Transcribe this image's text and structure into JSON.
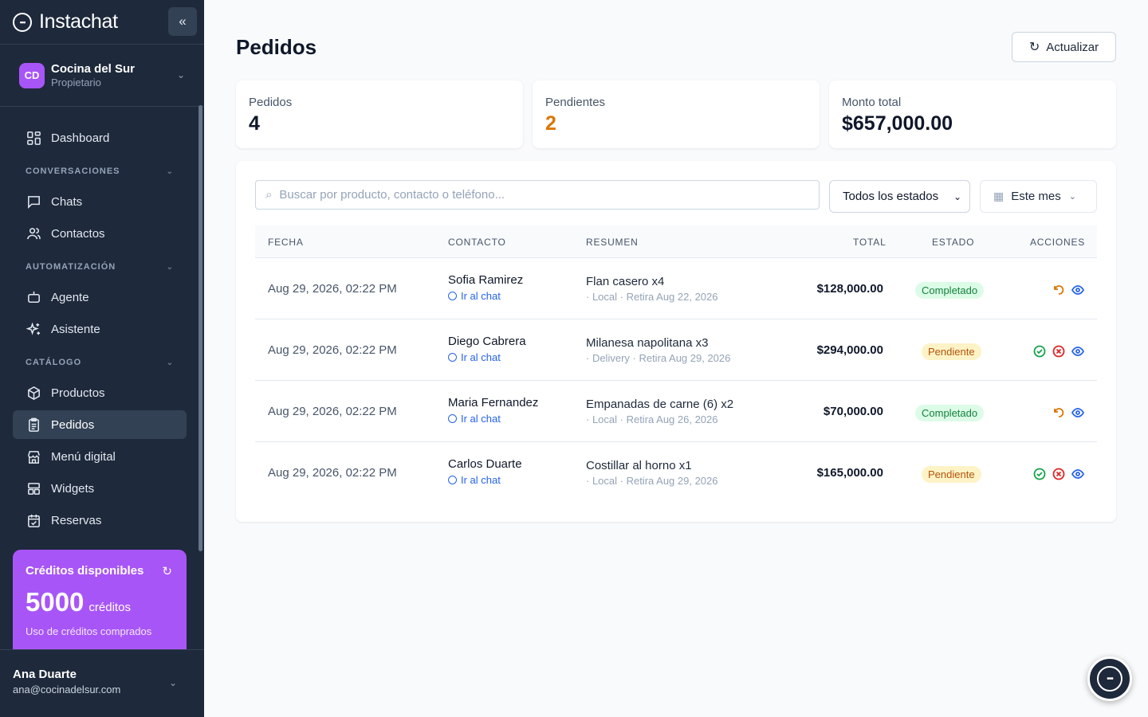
{
  "app": {
    "name": "Instachat"
  },
  "org": {
    "initials": "CD",
    "name": "Cocina del Sur",
    "role": "Propietario"
  },
  "nav": {
    "dashboard": "Dashboard",
    "sections": {
      "conversaciones": "CONVERSACIONES",
      "automatizacion": "AUTOMATIZACIÓN",
      "catalogo": "CATÁLOGO"
    },
    "items": {
      "chats": "Chats",
      "contactos": "Contactos",
      "agente": "Agente",
      "asistente": "Asistente",
      "productos": "Productos",
      "pedidos": "Pedidos",
      "menu": "Menú digital",
      "widgets": "Widgets",
      "reservas": "Reservas"
    }
  },
  "credits": {
    "title": "Créditos disponibles",
    "amount": "5000",
    "unit": "créditos",
    "subtitle": "Uso de créditos comprados"
  },
  "user": {
    "name": "Ana Duarte",
    "email": "ana@cocinadelsur.com"
  },
  "page": {
    "title": "Pedidos",
    "refresh_label": "Actualizar"
  },
  "stats": [
    {
      "label": "Pedidos",
      "value": "4"
    },
    {
      "label": "Pendientes",
      "value": "2"
    },
    {
      "label": "Monto total",
      "value": "$657,000.00"
    }
  ],
  "filters": {
    "search_placeholder": "Buscar por producto, contacto o teléfono...",
    "status_selected": "Todos los estados",
    "period_selected": "Este mes"
  },
  "table": {
    "headers": [
      "FECHA",
      "CONTACTO",
      "RESUMEN",
      "TOTAL",
      "ESTADO",
      "ACCIONES"
    ],
    "chat_link": "Ir al chat",
    "rows": [
      {
        "date": "Aug 29, 2026, 02:22 PM",
        "contact": "Sofia Ramirez",
        "product": "Flan casero x4",
        "meta": "· Local · Retira Aug 22, 2026",
        "total": "$128,000.00",
        "status": "Completado"
      },
      {
        "date": "Aug 29, 2026, 02:22 PM",
        "contact": "Diego Cabrera",
        "product": "Milanesa napolitana x3",
        "meta": "· Delivery · Retira Aug 29, 2026",
        "total": "$294,000.00",
        "status": "Pendiente"
      },
      {
        "date": "Aug 29, 2026, 02:22 PM",
        "contact": "Maria Fernandez",
        "product": "Empanadas de carne (6) x2",
        "meta": "· Local · Retira Aug 26, 2026",
        "total": "$70,000.00",
        "status": "Completado"
      },
      {
        "date": "Aug 29, 2026, 02:22 PM",
        "contact": "Carlos Duarte",
        "product": "Costillar al horno x1",
        "meta": "· Local · Retira Aug 29, 2026",
        "total": "$165,000.00",
        "status": "Pendiente"
      }
    ]
  },
  "colors": {
    "sidebar": "#1e293b",
    "accent": "#a855f7",
    "completed": "#15803d",
    "pending": "#b45309",
    "link": "#2563eb"
  }
}
